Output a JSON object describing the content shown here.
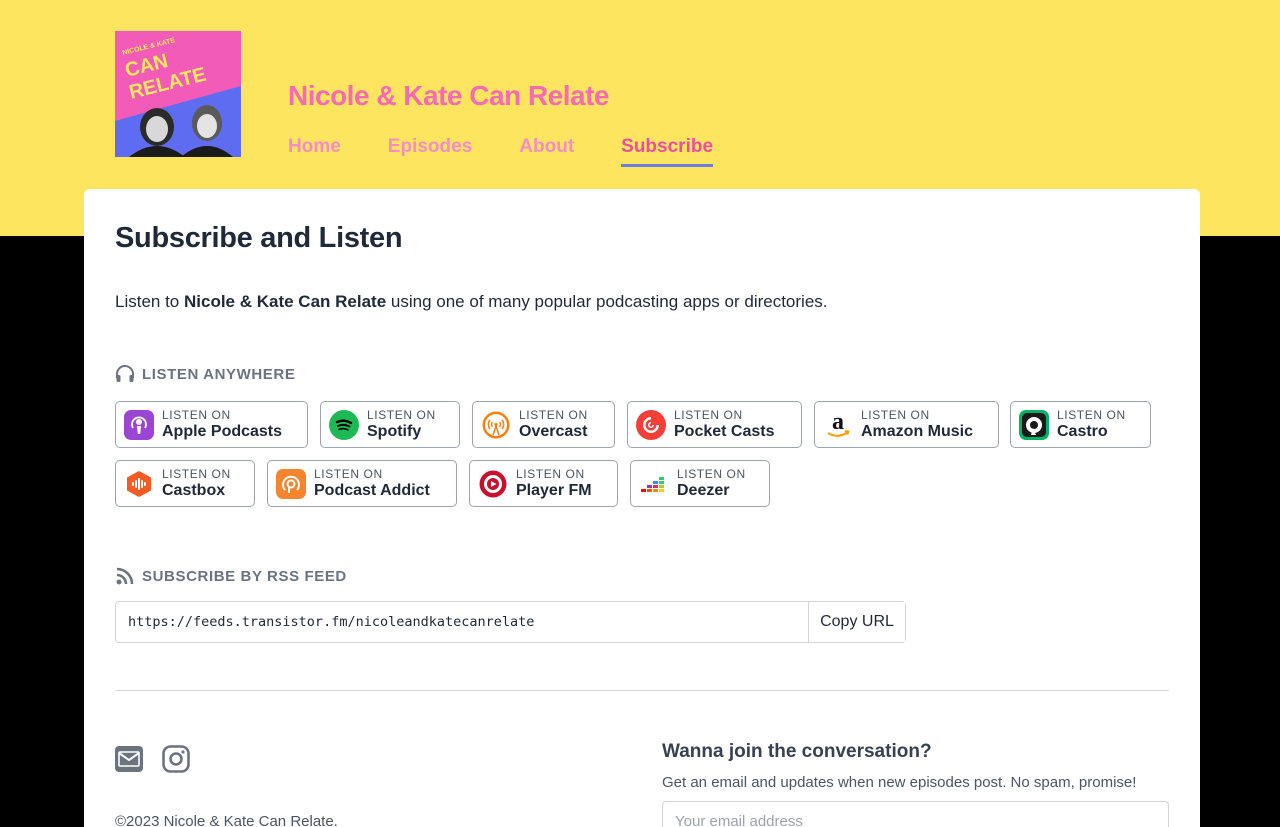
{
  "podcast": {
    "title": "Nicole & Kate Can Relate",
    "artwork_text_top": "NICOLE & KATE",
    "artwork_text_main_1": "CAN",
    "artwork_text_main_2": "RELATE"
  },
  "nav": {
    "items": [
      {
        "label": "Home"
      },
      {
        "label": "Episodes"
      },
      {
        "label": "About"
      },
      {
        "label": "Subscribe",
        "active": true
      }
    ]
  },
  "page": {
    "heading": "Subscribe and Listen",
    "intro_prefix": "Listen to ",
    "intro_name": "Nicole & Kate Can Relate",
    "intro_suffix": " using one of many popular podcasting apps or directories."
  },
  "listen": {
    "heading": "LISTEN ANYWHERE",
    "prefix": "LISTEN ON",
    "apps": [
      {
        "name": "Apple Podcasts",
        "icon": "apple-podcasts-icon"
      },
      {
        "name": "Spotify",
        "icon": "spotify-icon"
      },
      {
        "name": "Overcast",
        "icon": "overcast-icon"
      },
      {
        "name": "Pocket Casts",
        "icon": "pocket-casts-icon"
      },
      {
        "name": "Amazon Music",
        "icon": "amazon-music-icon"
      },
      {
        "name": "Castro",
        "icon": "castro-icon"
      },
      {
        "name": "Castbox",
        "icon": "castbox-icon"
      },
      {
        "name": "Podcast Addict",
        "icon": "podcast-addict-icon"
      },
      {
        "name": "Player FM",
        "icon": "player-fm-icon"
      },
      {
        "name": "Deezer",
        "icon": "deezer-icon"
      }
    ]
  },
  "rss": {
    "heading": "SUBSCRIBE BY RSS FEED",
    "url": "https://feeds.transistor.fm/nicoleandkatecanrelate",
    "copy_label": "Copy URL"
  },
  "footer": {
    "copyright": "©2023 Nicole & Kate Can Relate.",
    "join_heading": "Wanna join the conversation?",
    "join_text": "Get an email and updates when new episodes post. No spam, promise!",
    "email_placeholder": "Your email address"
  },
  "colors": {
    "hero_bg": "#fee55f",
    "title_pink": "#f56bb6",
    "nav_underline": "#6b7fe0"
  }
}
